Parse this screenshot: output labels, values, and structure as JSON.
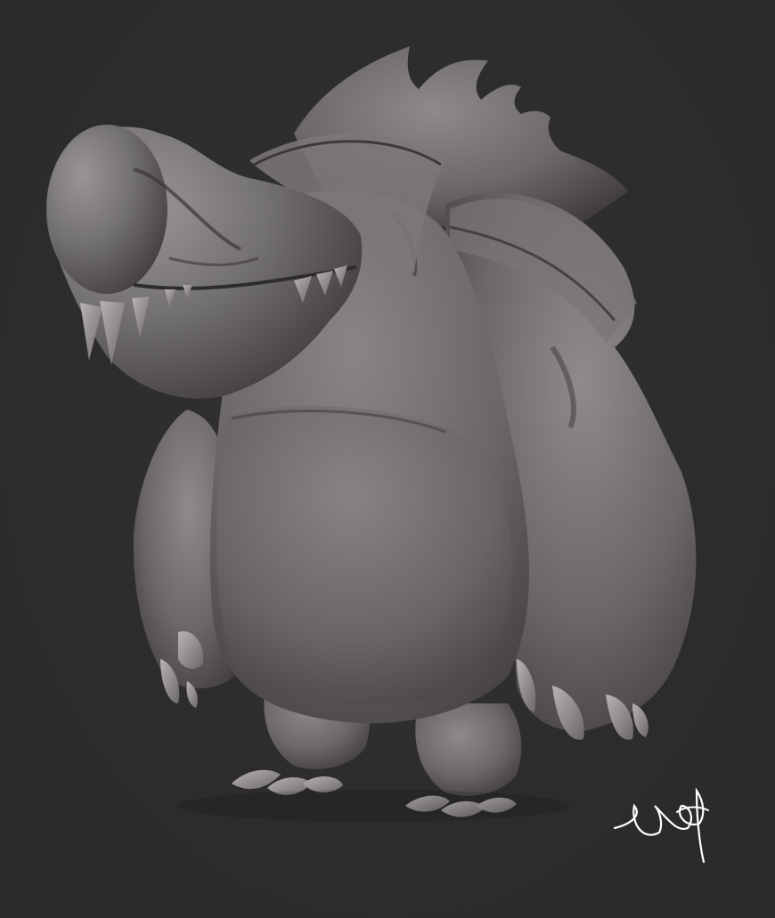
{
  "scene": {
    "subject": "creature-sculpt",
    "colors": {
      "background": "#2d2d2e",
      "clay_light": "#8f8b8b",
      "clay_mid": "#6f6a6a",
      "clay_dark": "#3e3a3a",
      "signature": "#ffffff"
    }
  },
  "signature": {
    "icon": "artist-signature"
  }
}
